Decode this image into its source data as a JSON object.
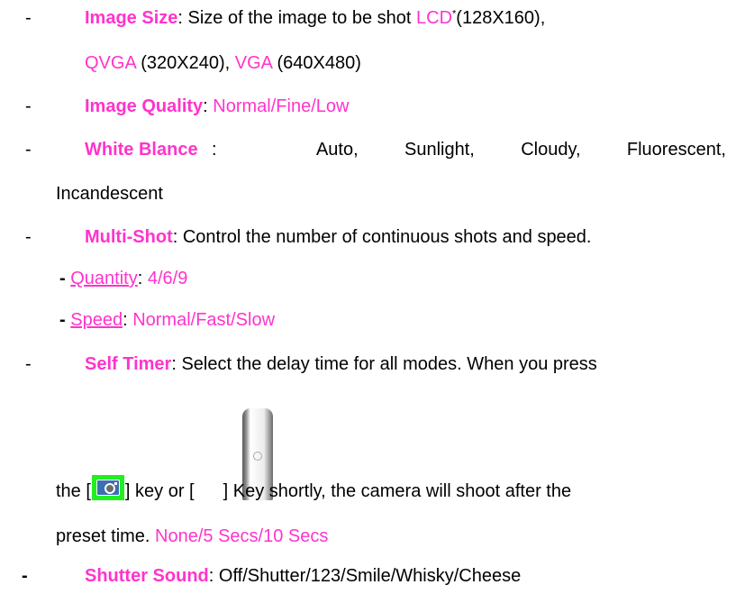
{
  "dash": "-",
  "items": {
    "image_size": {
      "label": "Image Size",
      "text": ": Size of the image to be shot ",
      "lcd": "LCD",
      "lcd_note": "*",
      "lcd_dims": "(128X160),",
      "qvga": "QVGA",
      "qvga_dims": " (320X240), ",
      "vga": "VGA",
      "vga_dims": " (640X480)"
    },
    "image_quality": {
      "label": "Image Quality",
      "colon": ": ",
      "options": "Normal/Fine/Low"
    },
    "white_balance": {
      "label": "White Blance",
      "options_line1": [
        ":",
        "Auto,",
        "Sunlight,",
        "Cloudy,",
        "Fluorescent,"
      ],
      "options_line2": "Incandescent"
    },
    "multi_shot": {
      "label": "Multi-Shot",
      "text": ": Control the number of continuous shots and speed.",
      "sub_dash": "-",
      "quantity_label": "Quantity",
      "colon": ": ",
      "quantity_options": "4/6/9",
      "speed_label": "Speed",
      "speed_options": "Normal/Fast/Slow"
    },
    "self_timer": {
      "label": "Self Timer",
      "text": ": Select the delay time for all modes. When you press",
      "line2_a": "the [",
      "line2_b": "] key or [",
      "line2_c": "] Key shortly, the camera will shoot after the",
      "line3": "preset time. ",
      "options": "None/5 Secs/10 Secs",
      "camera_key_icon": "camera-key-icon",
      "side_key_icon": "side-key-icon"
    },
    "shutter_sound": {
      "dash": "-",
      "label": "Shutter Sound",
      "colon": ": ",
      "options": "Off/Shutter/123/Smile/Whisky/Cheese"
    }
  },
  "colors": {
    "accent": "#ff33cc",
    "camera_key_bg": "#22ee22",
    "camera_body": "#3b6fb4"
  }
}
